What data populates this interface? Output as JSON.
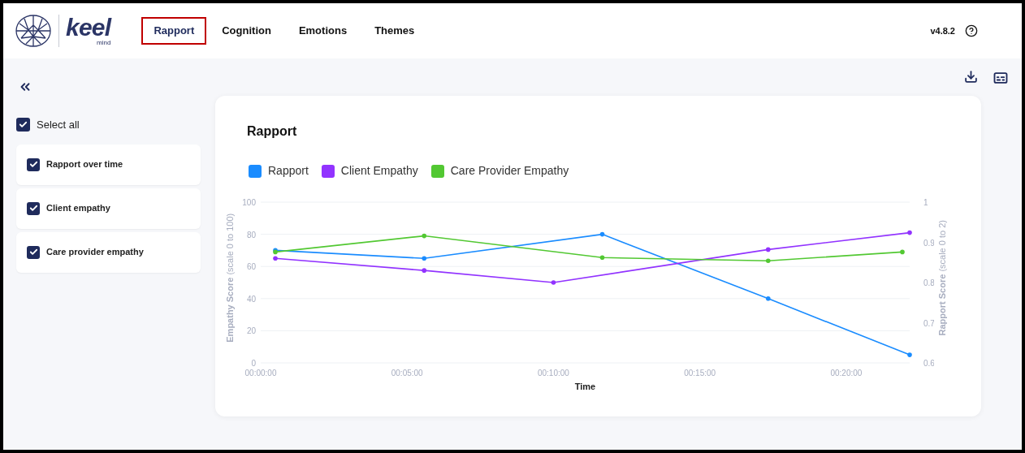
{
  "logo": {
    "wordmark": "keel",
    "tagline": "mind"
  },
  "tabs": [
    {
      "label": "Rapport",
      "selected": true
    },
    {
      "label": "Cognition",
      "selected": false
    },
    {
      "label": "Emotions",
      "selected": false
    },
    {
      "label": "Themes",
      "selected": false
    }
  ],
  "version": "v4.8.2",
  "sidebar": {
    "select_all": {
      "label": "Select all",
      "checked": true
    },
    "items": [
      {
        "label": "Rapport over time",
        "checked": true
      },
      {
        "label": "Client empathy",
        "checked": true
      },
      {
        "label": "Care provider empathy",
        "checked": true
      }
    ]
  },
  "card": {
    "title": "Rapport",
    "chart_data": {
      "type": "line",
      "xlabel": "Time",
      "ylabel": "**Empathy Score** (scale 0 to 100)",
      "y2label": "**Rapport Score** (scale 0 to 2)",
      "x": [
        30,
        335,
        600,
        700,
        1040,
        1315,
        1330
      ],
      "grid": true,
      "legend": "top",
      "xlim": [
        0,
        1330
      ],
      "ylim": [
        0,
        100
      ],
      "y2lim": [
        0.6,
        1
      ],
      "xticks": [
        {
          "value": 0,
          "label": "00:00:00"
        },
        {
          "value": 300,
          "label": "00:05:00"
        },
        {
          "value": 600,
          "label": "00:10:00"
        },
        {
          "value": 900,
          "label": "00:15:00"
        },
        {
          "value": 1200,
          "label": "00:20:00"
        }
      ],
      "yticks": [
        0,
        20,
        40,
        60,
        80,
        100
      ],
      "y2ticks": [
        {
          "value": 0.6,
          "label": "0.6"
        },
        {
          "value": 0.7,
          "label": "0.7"
        },
        {
          "value": 0.8,
          "label": "0.8"
        },
        {
          "value": 0.9,
          "label": "0.9"
        },
        {
          "value": 1,
          "label": "1"
        }
      ],
      "series": [
        {
          "name": "Rapport",
          "color": "#1a8cff",
          "axis": "y2",
          "values": [
            0.88,
            0.86,
            null,
            0.92,
            0.76,
            null,
            0.62
          ]
        },
        {
          "name": "Client Empathy",
          "color": "#9233ff",
          "values": [
            65,
            57.5,
            50,
            null,
            70.5,
            null,
            81
          ]
        },
        {
          "name": "Care Provider Empathy",
          "color": "#52c832",
          "values": [
            69,
            79,
            null,
            65.5,
            63.5,
            69,
            null
          ]
        }
      ]
    }
  }
}
